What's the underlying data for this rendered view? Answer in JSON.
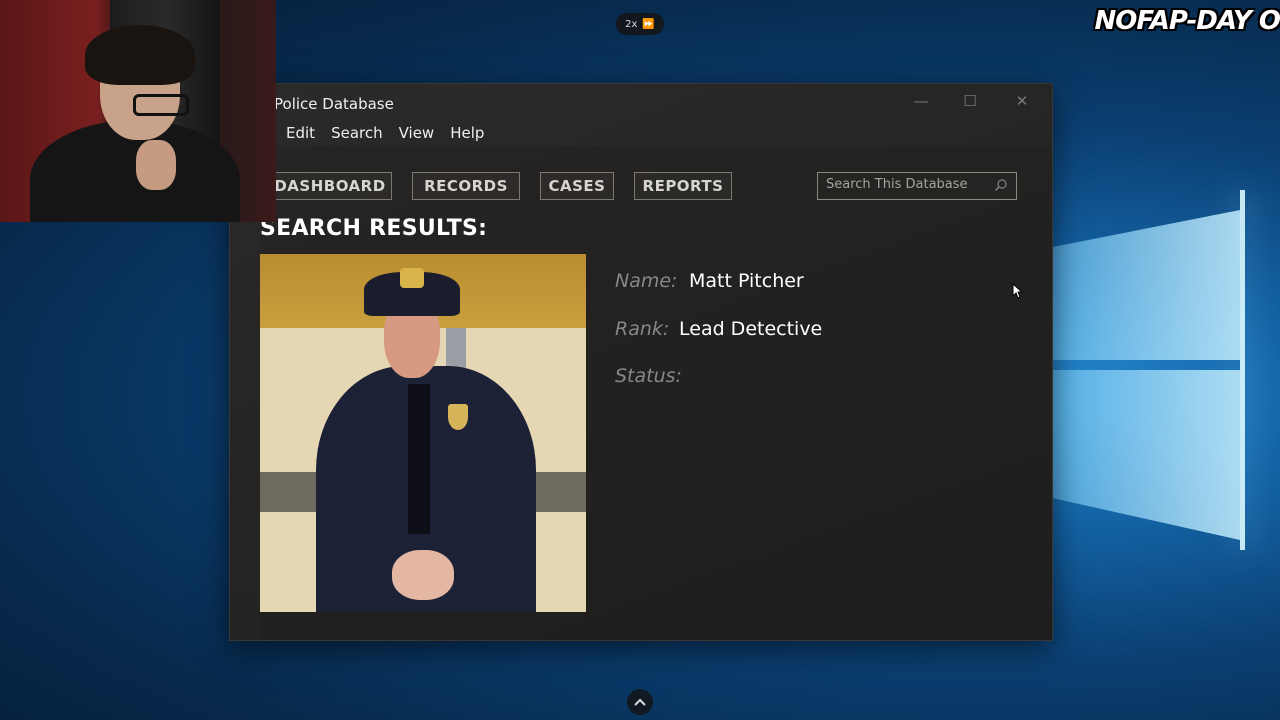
{
  "overlay": {
    "playback_speed": "2x",
    "stream_title": "NOFAP-DAY O"
  },
  "window": {
    "title": "Police Database",
    "controls": {
      "minimize": "—",
      "maximize": "☐",
      "close": "✕"
    }
  },
  "menu": [
    "Edit",
    "Search",
    "View",
    "Help"
  ],
  "nav_tabs": [
    "DASHBOARD",
    "RECORDS",
    "CASES",
    "REPORTS"
  ],
  "search": {
    "placeholder": "Search This Database"
  },
  "results": {
    "heading": "SEARCH RESULTS:",
    "fields": [
      {
        "label": "Name:",
        "value": "Matt Pitcher"
      },
      {
        "label": "Rank:",
        "value": "Lead Detective"
      },
      {
        "label": "Status:",
        "value": ""
      }
    ]
  },
  "colors": {
    "window_bg": "#262422",
    "label": "#8a8886",
    "value": "#ffffff",
    "desktop": "#0b3f72"
  }
}
